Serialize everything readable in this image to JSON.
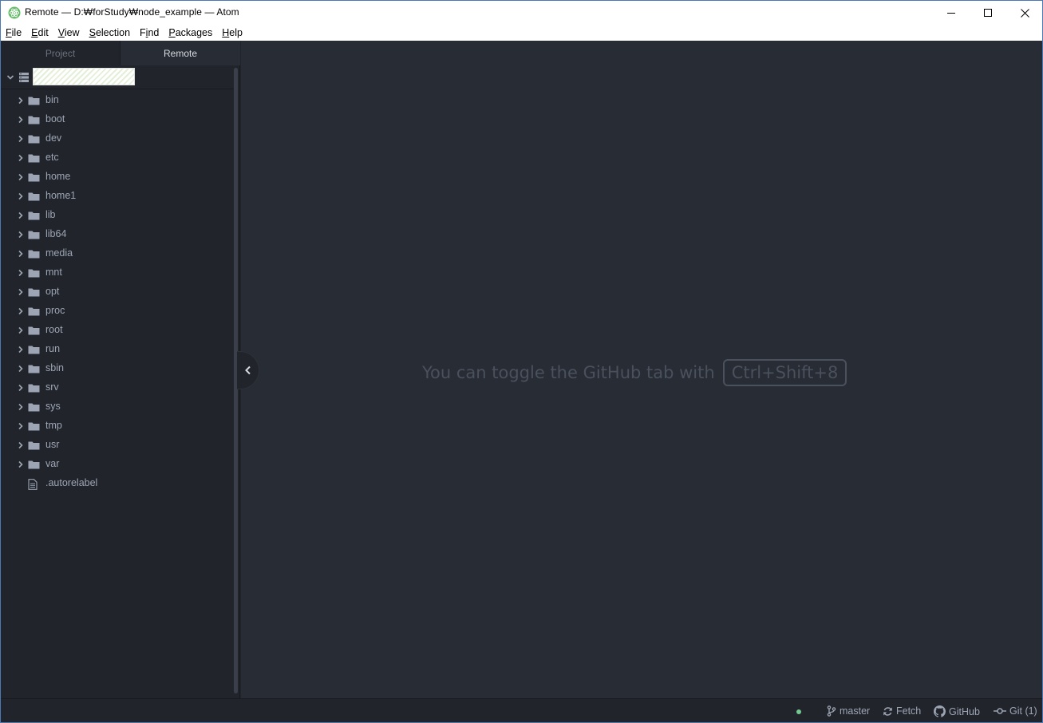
{
  "window": {
    "title": "Remote — D:₩forStudy₩node_example — Atom"
  },
  "menu": [
    {
      "key": "F",
      "rest": "ile"
    },
    {
      "key": "E",
      "rest": "dit"
    },
    {
      "key": "V",
      "rest": "iew"
    },
    {
      "key": "S",
      "rest": "election"
    },
    {
      "key": "F",
      "rest": "ind",
      "keyIndex": 1
    },
    {
      "key": "P",
      "rest": "ackages"
    },
    {
      "key": "H",
      "rest": "elp"
    }
  ],
  "menu_labels": {
    "file_pre": "",
    "file_key": "F",
    "file_rest": "ile",
    "edit_pre": "",
    "edit_key": "E",
    "edit_rest": "dit",
    "view_pre": "",
    "view_key": "V",
    "view_rest": "iew",
    "selection_pre": "",
    "selection_key": "S",
    "selection_rest": "election",
    "find_pre": "F",
    "find_key": "i",
    "find_rest": "nd",
    "packages_pre": "",
    "packages_key": "P",
    "packages_rest": "ackages",
    "help_pre": "",
    "help_key": "H",
    "help_rest": "elp"
  },
  "dock": {
    "tabs": [
      {
        "label": "Project",
        "active": false
      },
      {
        "label": "Remote",
        "active": true
      }
    ],
    "tree": {
      "folders": [
        "bin",
        "boot",
        "dev",
        "etc",
        "home",
        "home1",
        "lib",
        "lib64",
        "media",
        "mnt",
        "opt",
        "proc",
        "root",
        "run",
        "sbin",
        "srv",
        "sys",
        "tmp",
        "usr",
        "var"
      ],
      "files": [
        ".autorelabel"
      ]
    }
  },
  "editor": {
    "hint_text": "You can toggle the GitHub tab with",
    "hint_shortcut": "Ctrl+Shift+8"
  },
  "statusbar": {
    "branch": "master",
    "fetch": "Fetch",
    "github": "GitHub",
    "git": "Git (1)"
  },
  "colors": {
    "background": "#21252b",
    "editor_background": "#282c34",
    "text": "#9da5b4",
    "status_dot": "#73c990"
  }
}
